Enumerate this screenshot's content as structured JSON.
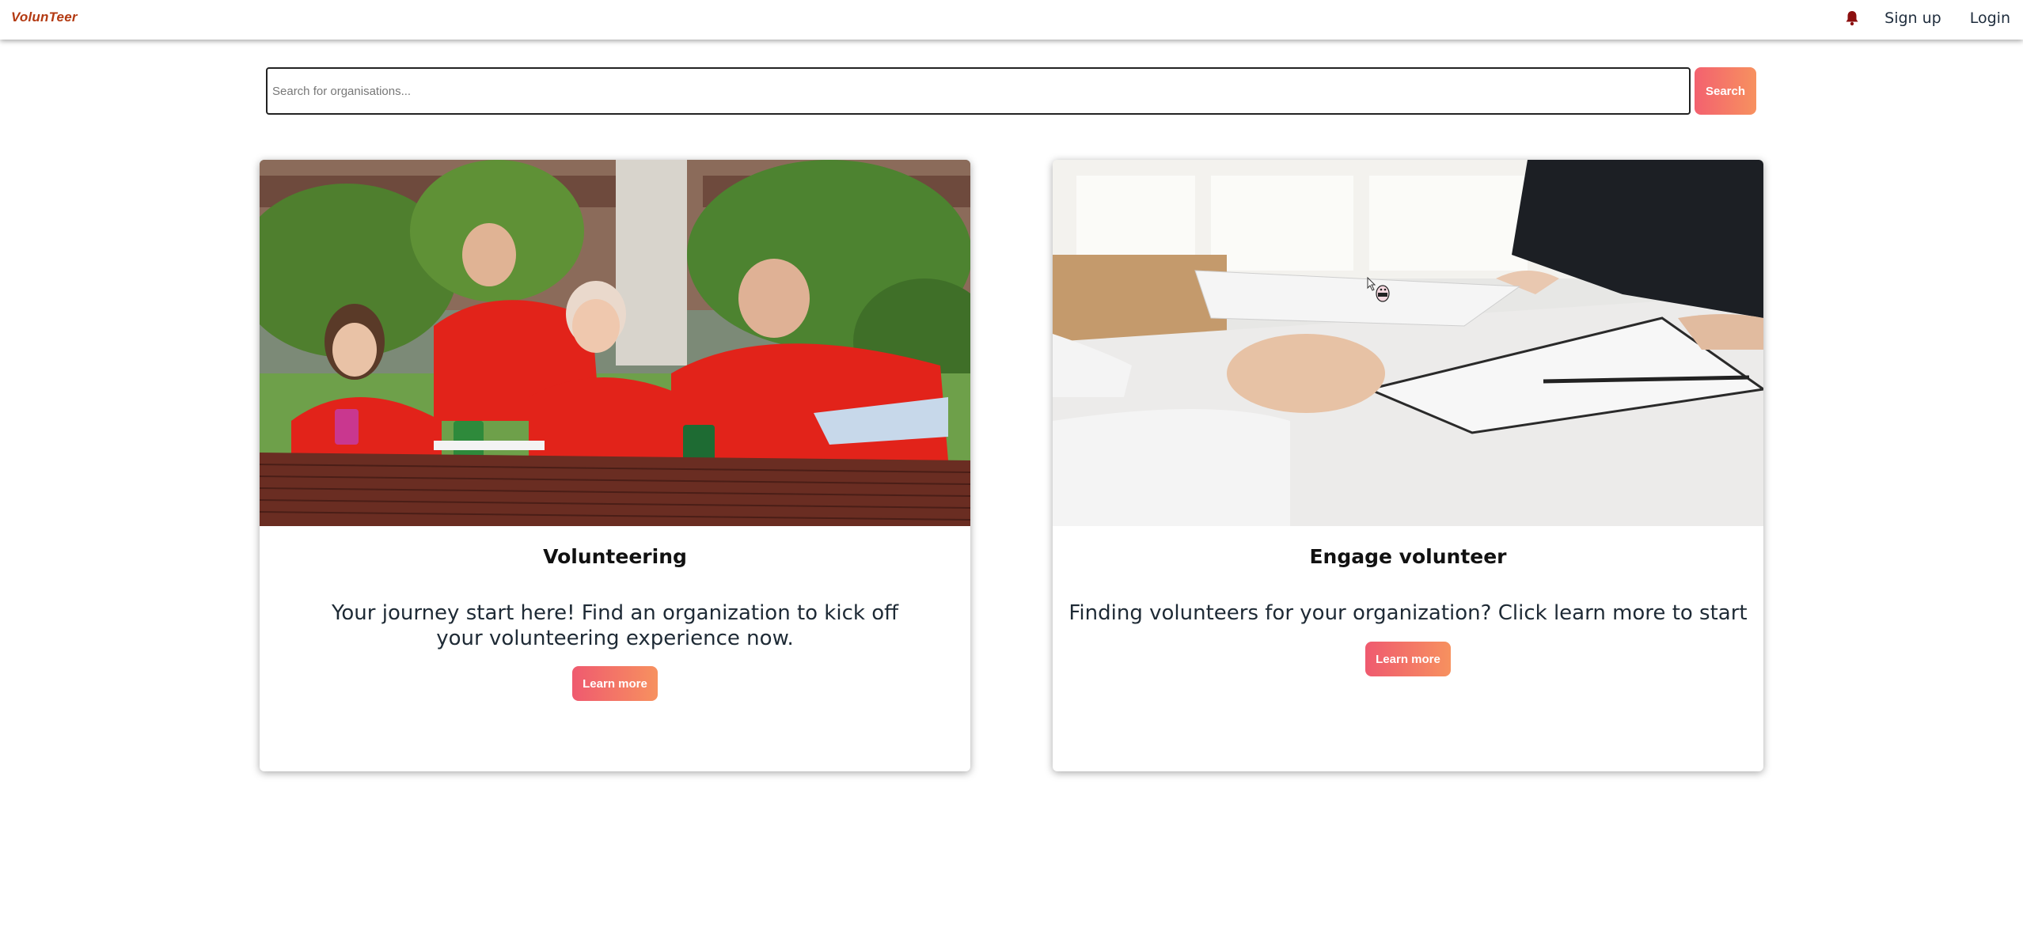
{
  "navbar": {
    "brand": "VolunTeer",
    "bell_icon": "bell-icon",
    "signup_label": "Sign up",
    "login_label": "Login"
  },
  "search": {
    "placeholder": "Search for organisations...",
    "button_label": "Search"
  },
  "cards": [
    {
      "title": "Volunteering",
      "text": "Your journey start here! Find an organization to kick off your volunteering experience now.",
      "button_label": "Learn more",
      "image": "volunteers-photo"
    },
    {
      "title": "Engage volunteer",
      "text": "Finding volunteers for your organization? Click learn more to start",
      "button_label": "Learn more",
      "image": "handshake-documents-photo"
    }
  ],
  "colors": {
    "brand": "#b33a12",
    "button_gradient_start": "#f3616f",
    "button_gradient_end": "#f7915f",
    "bell": "#8b0f0f"
  }
}
